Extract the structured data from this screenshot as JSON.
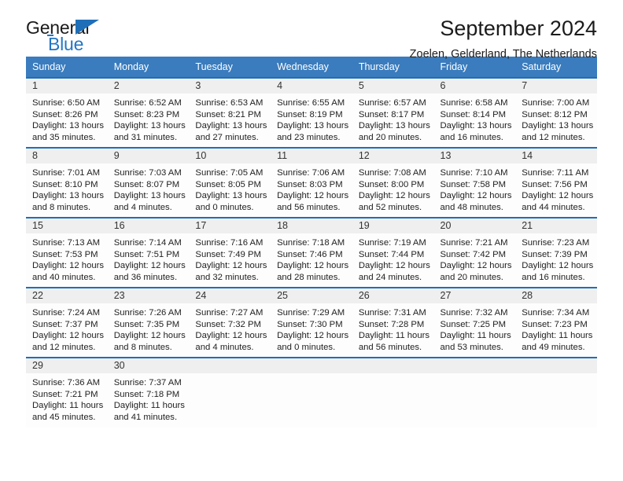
{
  "brand": {
    "name_dark": "General",
    "name_blue": "Blue",
    "accent_color": "#1f6fb8",
    "header_bg": "#3a7cbe"
  },
  "header": {
    "title": "September 2024",
    "subtitle": "Zoelen, Gelderland, The Netherlands"
  },
  "weekday_headers": [
    "Sunday",
    "Monday",
    "Tuesday",
    "Wednesday",
    "Thursday",
    "Friday",
    "Saturday"
  ],
  "labels": {
    "sunrise_prefix": "Sunrise:",
    "sunset_prefix": "Sunset:",
    "daylight_prefix": "Daylight:"
  },
  "weeks": [
    [
      {
        "day": "1",
        "sunrise": "Sunrise: 6:50 AM",
        "sunset": "Sunset: 8:26 PM",
        "daylight_1": "Daylight: 13 hours",
        "daylight_2": "and 35 minutes."
      },
      {
        "day": "2",
        "sunrise": "Sunrise: 6:52 AM",
        "sunset": "Sunset: 8:23 PM",
        "daylight_1": "Daylight: 13 hours",
        "daylight_2": "and 31 minutes."
      },
      {
        "day": "3",
        "sunrise": "Sunrise: 6:53 AM",
        "sunset": "Sunset: 8:21 PM",
        "daylight_1": "Daylight: 13 hours",
        "daylight_2": "and 27 minutes."
      },
      {
        "day": "4",
        "sunrise": "Sunrise: 6:55 AM",
        "sunset": "Sunset: 8:19 PM",
        "daylight_1": "Daylight: 13 hours",
        "daylight_2": "and 23 minutes."
      },
      {
        "day": "5",
        "sunrise": "Sunrise: 6:57 AM",
        "sunset": "Sunset: 8:17 PM",
        "daylight_1": "Daylight: 13 hours",
        "daylight_2": "and 20 minutes."
      },
      {
        "day": "6",
        "sunrise": "Sunrise: 6:58 AM",
        "sunset": "Sunset: 8:14 PM",
        "daylight_1": "Daylight: 13 hours",
        "daylight_2": "and 16 minutes."
      },
      {
        "day": "7",
        "sunrise": "Sunrise: 7:00 AM",
        "sunset": "Sunset: 8:12 PM",
        "daylight_1": "Daylight: 13 hours",
        "daylight_2": "and 12 minutes."
      }
    ],
    [
      {
        "day": "8",
        "sunrise": "Sunrise: 7:01 AM",
        "sunset": "Sunset: 8:10 PM",
        "daylight_1": "Daylight: 13 hours",
        "daylight_2": "and 8 minutes."
      },
      {
        "day": "9",
        "sunrise": "Sunrise: 7:03 AM",
        "sunset": "Sunset: 8:07 PM",
        "daylight_1": "Daylight: 13 hours",
        "daylight_2": "and 4 minutes."
      },
      {
        "day": "10",
        "sunrise": "Sunrise: 7:05 AM",
        "sunset": "Sunset: 8:05 PM",
        "daylight_1": "Daylight: 13 hours",
        "daylight_2": "and 0 minutes."
      },
      {
        "day": "11",
        "sunrise": "Sunrise: 7:06 AM",
        "sunset": "Sunset: 8:03 PM",
        "daylight_1": "Daylight: 12 hours",
        "daylight_2": "and 56 minutes."
      },
      {
        "day": "12",
        "sunrise": "Sunrise: 7:08 AM",
        "sunset": "Sunset: 8:00 PM",
        "daylight_1": "Daylight: 12 hours",
        "daylight_2": "and 52 minutes."
      },
      {
        "day": "13",
        "sunrise": "Sunrise: 7:10 AM",
        "sunset": "Sunset: 7:58 PM",
        "daylight_1": "Daylight: 12 hours",
        "daylight_2": "and 48 minutes."
      },
      {
        "day": "14",
        "sunrise": "Sunrise: 7:11 AM",
        "sunset": "Sunset: 7:56 PM",
        "daylight_1": "Daylight: 12 hours",
        "daylight_2": "and 44 minutes."
      }
    ],
    [
      {
        "day": "15",
        "sunrise": "Sunrise: 7:13 AM",
        "sunset": "Sunset: 7:53 PM",
        "daylight_1": "Daylight: 12 hours",
        "daylight_2": "and 40 minutes."
      },
      {
        "day": "16",
        "sunrise": "Sunrise: 7:14 AM",
        "sunset": "Sunset: 7:51 PM",
        "daylight_1": "Daylight: 12 hours",
        "daylight_2": "and 36 minutes."
      },
      {
        "day": "17",
        "sunrise": "Sunrise: 7:16 AM",
        "sunset": "Sunset: 7:49 PM",
        "daylight_1": "Daylight: 12 hours",
        "daylight_2": "and 32 minutes."
      },
      {
        "day": "18",
        "sunrise": "Sunrise: 7:18 AM",
        "sunset": "Sunset: 7:46 PM",
        "daylight_1": "Daylight: 12 hours",
        "daylight_2": "and 28 minutes."
      },
      {
        "day": "19",
        "sunrise": "Sunrise: 7:19 AM",
        "sunset": "Sunset: 7:44 PM",
        "daylight_1": "Daylight: 12 hours",
        "daylight_2": "and 24 minutes."
      },
      {
        "day": "20",
        "sunrise": "Sunrise: 7:21 AM",
        "sunset": "Sunset: 7:42 PM",
        "daylight_1": "Daylight: 12 hours",
        "daylight_2": "and 20 minutes."
      },
      {
        "day": "21",
        "sunrise": "Sunrise: 7:23 AM",
        "sunset": "Sunset: 7:39 PM",
        "daylight_1": "Daylight: 12 hours",
        "daylight_2": "and 16 minutes."
      }
    ],
    [
      {
        "day": "22",
        "sunrise": "Sunrise: 7:24 AM",
        "sunset": "Sunset: 7:37 PM",
        "daylight_1": "Daylight: 12 hours",
        "daylight_2": "and 12 minutes."
      },
      {
        "day": "23",
        "sunrise": "Sunrise: 7:26 AM",
        "sunset": "Sunset: 7:35 PM",
        "daylight_1": "Daylight: 12 hours",
        "daylight_2": "and 8 minutes."
      },
      {
        "day": "24",
        "sunrise": "Sunrise: 7:27 AM",
        "sunset": "Sunset: 7:32 PM",
        "daylight_1": "Daylight: 12 hours",
        "daylight_2": "and 4 minutes."
      },
      {
        "day": "25",
        "sunrise": "Sunrise: 7:29 AM",
        "sunset": "Sunset: 7:30 PM",
        "daylight_1": "Daylight: 12 hours",
        "daylight_2": "and 0 minutes."
      },
      {
        "day": "26",
        "sunrise": "Sunrise: 7:31 AM",
        "sunset": "Sunset: 7:28 PM",
        "daylight_1": "Daylight: 11 hours",
        "daylight_2": "and 56 minutes."
      },
      {
        "day": "27",
        "sunrise": "Sunrise: 7:32 AM",
        "sunset": "Sunset: 7:25 PM",
        "daylight_1": "Daylight: 11 hours",
        "daylight_2": "and 53 minutes."
      },
      {
        "day": "28",
        "sunrise": "Sunrise: 7:34 AM",
        "sunset": "Sunset: 7:23 PM",
        "daylight_1": "Daylight: 11 hours",
        "daylight_2": "and 49 minutes."
      }
    ],
    [
      {
        "day": "29",
        "sunrise": "Sunrise: 7:36 AM",
        "sunset": "Sunset: 7:21 PM",
        "daylight_1": "Daylight: 11 hours",
        "daylight_2": "and 45 minutes."
      },
      {
        "day": "30",
        "sunrise": "Sunrise: 7:37 AM",
        "sunset": "Sunset: 7:18 PM",
        "daylight_1": "Daylight: 11 hours",
        "daylight_2": "and 41 minutes."
      },
      {
        "day": "",
        "sunrise": "",
        "sunset": "",
        "daylight_1": "",
        "daylight_2": ""
      },
      {
        "day": "",
        "sunrise": "",
        "sunset": "",
        "daylight_1": "",
        "daylight_2": ""
      },
      {
        "day": "",
        "sunrise": "",
        "sunset": "",
        "daylight_1": "",
        "daylight_2": ""
      },
      {
        "day": "",
        "sunrise": "",
        "sunset": "",
        "daylight_1": "",
        "daylight_2": ""
      },
      {
        "day": "",
        "sunrise": "",
        "sunset": "",
        "daylight_1": "",
        "daylight_2": ""
      }
    ]
  ]
}
